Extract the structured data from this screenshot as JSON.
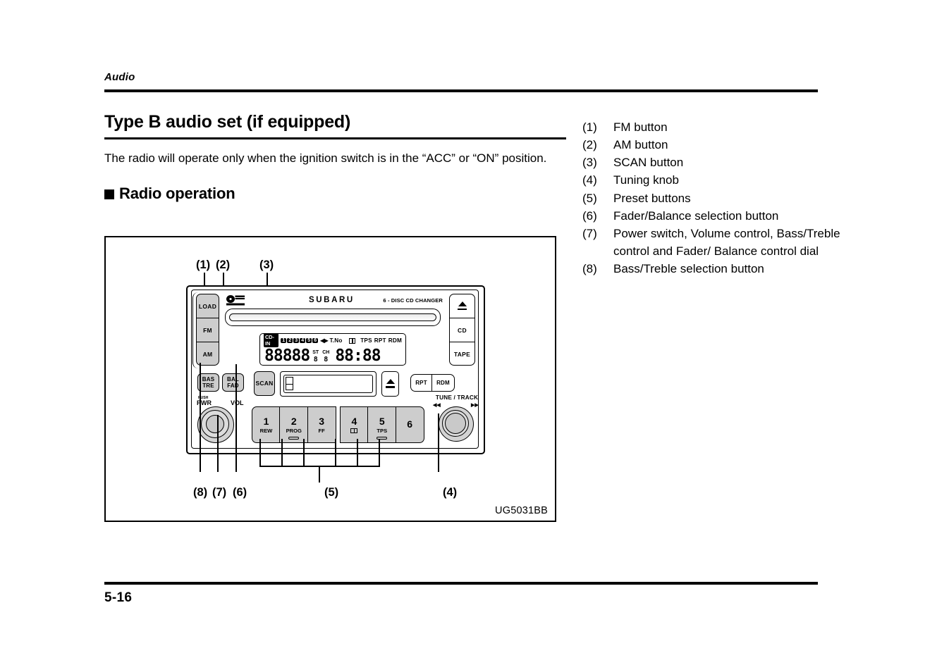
{
  "header": {
    "chapter": "Audio"
  },
  "footer": {
    "page": "5-16"
  },
  "main": {
    "section_title": "Type B audio set (if equipped)",
    "intro_paragraph": "The radio will operate only when the ignition switch is in the “ACC” or “ON” position.",
    "subsection_title": "Radio operation"
  },
  "figure": {
    "caption": "UG5031BB",
    "callouts_top": [
      {
        "id": "1",
        "label": "(1)"
      },
      {
        "id": "2",
        "label": "(2)"
      },
      {
        "id": "3",
        "label": "(3)"
      }
    ],
    "callouts_bottom": [
      {
        "id": "8",
        "label": "(8)"
      },
      {
        "id": "7",
        "label": "(7)"
      },
      {
        "id": "6",
        "label": "(6)"
      },
      {
        "id": "5",
        "label": "(5)"
      },
      {
        "id": "4",
        "label": "(4)"
      }
    ]
  },
  "radio": {
    "brand": "SUBARU",
    "changer_label": "6 - DISC CD CHANGER",
    "cd_logo_text": "COMPACT DISC",
    "left_buttons": [
      {
        "name": "load",
        "label": "LOAD"
      },
      {
        "name": "fm",
        "label": "FM"
      },
      {
        "name": "am",
        "label": "AM"
      }
    ],
    "right_buttons": [
      {
        "name": "eject",
        "label": ""
      },
      {
        "name": "cd",
        "label": "CD"
      },
      {
        "name": "tape",
        "label": "TAPE"
      }
    ],
    "lcd": {
      "cd_in": "CD-IN",
      "disc_numbers": [
        "1",
        "2",
        "3",
        "4",
        "5",
        "6"
      ],
      "track_arrows": "◀▶",
      "track_no": "T.No",
      "indicators": [
        "TPS",
        "RPT",
        "RDM"
      ],
      "main_digits": "88888",
      "st_label": "ST",
      "st_digits": "8",
      "ch_label": "CH",
      "ch_digits": "8",
      "clock_digits": "88:88"
    },
    "tone_buttons": [
      {
        "name": "bass-treble",
        "line1": "BAS",
        "line2": "TRE"
      },
      {
        "name": "balance-fader",
        "line1": "BAL",
        "line2": "FAD"
      }
    ],
    "scan_label": "SCAN",
    "rpt_label": "RPT",
    "rdm_label": "RDM",
    "power_push_label": "PUSH",
    "power_label": "PWR",
    "volume_label": "VOL",
    "tune_track_label": "TUNE / TRACK",
    "seek_prev": "◀◀",
    "seek_next": "▶▶",
    "presets": [
      {
        "num": "1",
        "sub": "REW",
        "pill": false,
        "dolby": false
      },
      {
        "num": "2",
        "sub": "PROG",
        "pill": true,
        "dolby": false
      },
      {
        "num": "3",
        "sub": "FF",
        "pill": false,
        "dolby": false
      },
      {
        "num": "4",
        "sub": "",
        "pill": false,
        "dolby": true
      },
      {
        "num": "5",
        "sub": "TPS",
        "pill": true,
        "dolby": false
      },
      {
        "num": "6",
        "sub": "",
        "pill": false,
        "dolby": false
      }
    ]
  },
  "legend": {
    "items": [
      {
        "num": "(1)",
        "text": "FM button"
      },
      {
        "num": "(2)",
        "text": "AM button"
      },
      {
        "num": "(3)",
        "text": "SCAN button"
      },
      {
        "num": "(4)",
        "text": "Tuning knob"
      },
      {
        "num": "(5)",
        "text": "Preset buttons"
      },
      {
        "num": "(6)",
        "text": "Fader/Balance selection button"
      },
      {
        "num": "(7)",
        "text": "Power switch, Volume control, Bass/Treble control and Fader/ Balance control dial"
      },
      {
        "num": "(8)",
        "text": "Bass/Treble selection button"
      }
    ]
  }
}
